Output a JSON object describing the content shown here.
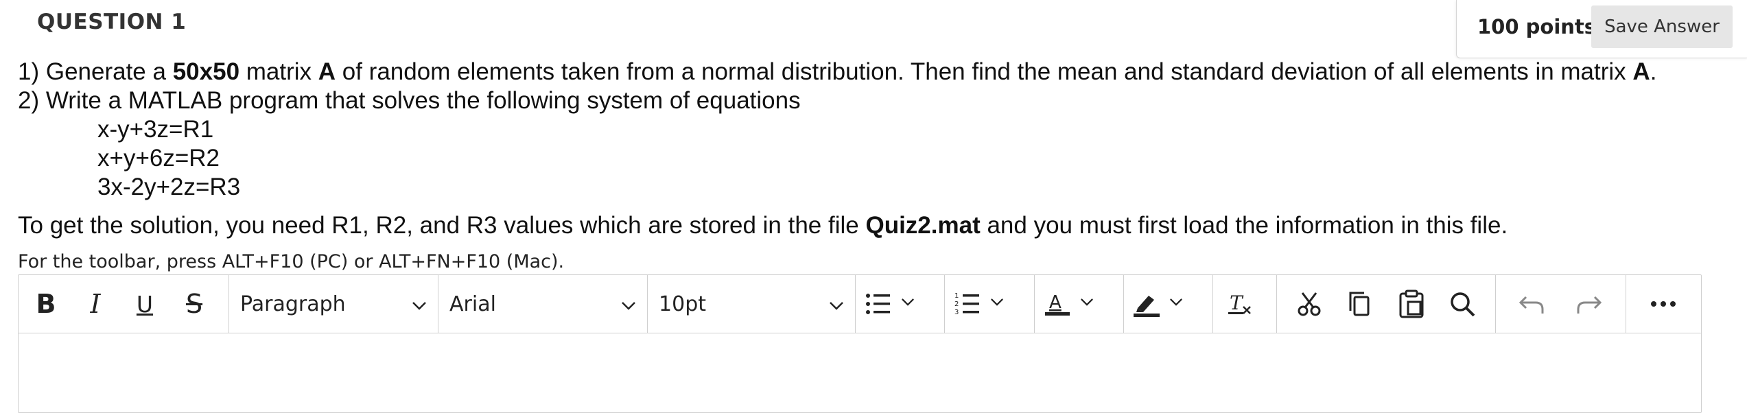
{
  "question": {
    "title": "QUESTION 1",
    "points": "100 points",
    "save_label": "Save Answer"
  },
  "body": {
    "line1_a": "1) Generate a ",
    "line1_b": "50x50",
    "line1_c": " matrix ",
    "line1_d": "A",
    "line1_e": " of random elements taken from a normal distribution. Then find the mean and standard deviation of all elements in matrix ",
    "line1_f": "A",
    "line1_g": ".",
    "line2": "2) Write a MATLAB program that solves the following system of equations",
    "eq1": "x-y+3z=R1",
    "eq2": "x+y+6z=R2",
    "eq3": "3x-2y+2z=R3",
    "line3_a": "To get the solution, you need R1, R2, and R3 values which are stored in the file ",
    "line3_b": "Quiz2.mat",
    "line3_c": " and you must first load the information in this file."
  },
  "hint": "For the toolbar, press ALT+F10 (PC) or ALT+FN+F10 (Mac).",
  "toolbar": {
    "bold": "B",
    "italic": "I",
    "underline": "U",
    "strike": "S",
    "block_format": "Paragraph",
    "font_family": "Arial",
    "font_size": "10pt"
  },
  "colors": {
    "text": "#1a1a1a",
    "border": "#cfcfcf",
    "button_bg": "#e6e6e6"
  }
}
